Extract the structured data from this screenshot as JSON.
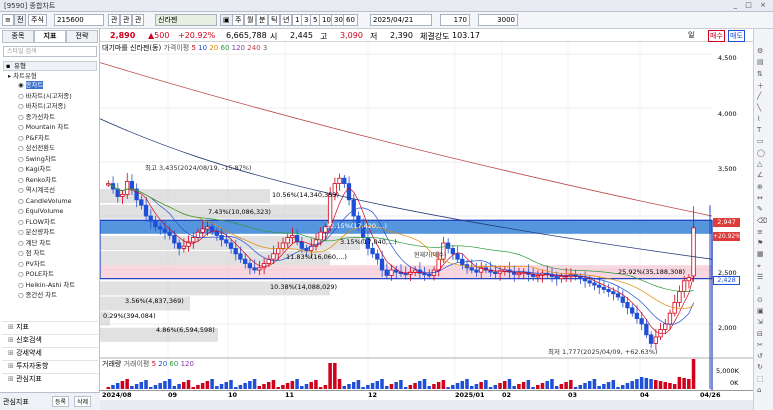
{
  "window": {
    "title": "[9590] 종합차트",
    "controls": "_ □ ×"
  },
  "toolbar": {
    "tab_price": "전",
    "tab_stock": "주식",
    "stock_code": "215600",
    "ticker_name": "신라젠",
    "periods": [
      "관",
      "분",
      "일",
      "주",
      "월",
      "분",
      "틱",
      "년"
    ],
    "period_items": [
      "주",
      "월",
      "분",
      "틱",
      "년",
      "1",
      "3",
      "5",
      "10",
      "30",
      "60"
    ],
    "date": "2025/04/21",
    "count": "170",
    "max_count": "3000"
  },
  "quote": {
    "price": "2,890",
    "change": "▲500",
    "change_pct": "+20.92%",
    "volume": "6,665,788",
    "open_label": "시",
    "open": "2,445",
    "high_label": "고",
    "high": "3,090",
    "low_label": "저",
    "low": "2,390",
    "strength_label": "체결강도",
    "strength": "103.17",
    "right_label_1": "일",
    "right_label_2": "매수",
    "right_label_3": "매도"
  },
  "leftpanel": {
    "tabs": [
      "종목",
      "지표",
      "전략"
    ],
    "search_placeholder": "스타일 검색",
    "group": "유형",
    "subgroup": "차트유형",
    "items": [
      "봉차트",
      "바차트(시고저종)",
      "바차트(고저종)",
      "종가선차트",
      "Mountain 차트",
      "P&F차트",
      "삼선전환도",
      "Swing차트",
      "Kagi차트",
      "Renko차트",
      "역시계곡선",
      "CandleVolume",
      "EquiVolume",
      "FLOW차트",
      "분산량차트",
      "계단 차트",
      "점 차트",
      "PV차트",
      "POLE차트",
      "Heikin-Ashi 차트",
      "종간선 차트"
    ],
    "sections": [
      "지표",
      "신호검색",
      "강세약세",
      "투자자동향",
      "관심지표"
    ],
    "bottom_tabs": [
      "관심지표",
      "등록",
      "삭제"
    ]
  },
  "chart_header": {
    "label": "대기마를",
    "name": "신라젠(동)",
    "ma_label": "가격이평",
    "ma_periods": [
      "5",
      "10",
      "20",
      "60",
      "120",
      "240",
      "3"
    ]
  },
  "volume_header": {
    "label": "거래량",
    "ma_label": "거래이평",
    "ma_periods": [
      "5",
      "20",
      "60",
      "120"
    ]
  },
  "annotations": {
    "high": "최고 3,435(2024/08/19, -15.87%)",
    "low": "최저 1,777(2025/04/09, +62.63%)",
    "current": "현재가(매수)",
    "profiles": [
      "10.56%(14,340,353)",
      "7.43%(10,086,323)",
      "12.15%(17,420,...)",
      "3.15%(17,040,...)",
      "11.83%(16,060,...)",
      "10.38%(14,088,029)",
      "25.92%(35,188,308)",
      "3.56%(4,837,369)",
      "0.29%(394,084)",
      "4.86%(6,594,598)"
    ]
  },
  "price_axis": {
    "ticks": [
      "4,500",
      "4,000",
      "3,500",
      "3,000",
      "2,500",
      "2,000"
    ],
    "marker_1": "2,947",
    "marker_2": "+20.92%",
    "marker_3": "2,428"
  },
  "volume_axis": {
    "ticks": [
      "5,000K",
      "0K"
    ]
  },
  "x_axis": {
    "labels": [
      "2024/08",
      "09",
      "10",
      "11",
      "12",
      "2025/01",
      "02",
      "03",
      "04",
      "04/26"
    ]
  },
  "chart_data": {
    "type": "candlestick",
    "x": [
      "2024/08",
      "09",
      "10",
      "11",
      "12",
      "2025/01",
      "02",
      "03",
      "04"
    ],
    "ylim": [
      1700,
      4600
    ],
    "ohlc_approx": [
      [
        3300,
        3435,
        3200,
        3300
      ],
      [
        3000,
        3100,
        2750,
        2850
      ],
      [
        2650,
        2800,
        2500,
        2600
      ],
      [
        2600,
        3200,
        2500,
        2600
      ],
      [
        3250,
        3300,
        2900,
        2500
      ],
      [
        2450,
        2750,
        2450,
        2550
      ],
      [
        2500,
        2550,
        2450,
        2500
      ],
      [
        2450,
        2500,
        2300,
        2400
      ],
      [
        1777,
        3090,
        1777,
        2890
      ]
    ],
    "price_high": 3435,
    "price_low": 1777,
    "current": 2890
  },
  "colors": {
    "up": "#d0021b",
    "down": "#1f4fd6",
    "band_blue": "#2a7bd6",
    "band_pink": "#f4b6c6",
    "profile": "#c8c8c8",
    "ma120": "#b44"
  }
}
